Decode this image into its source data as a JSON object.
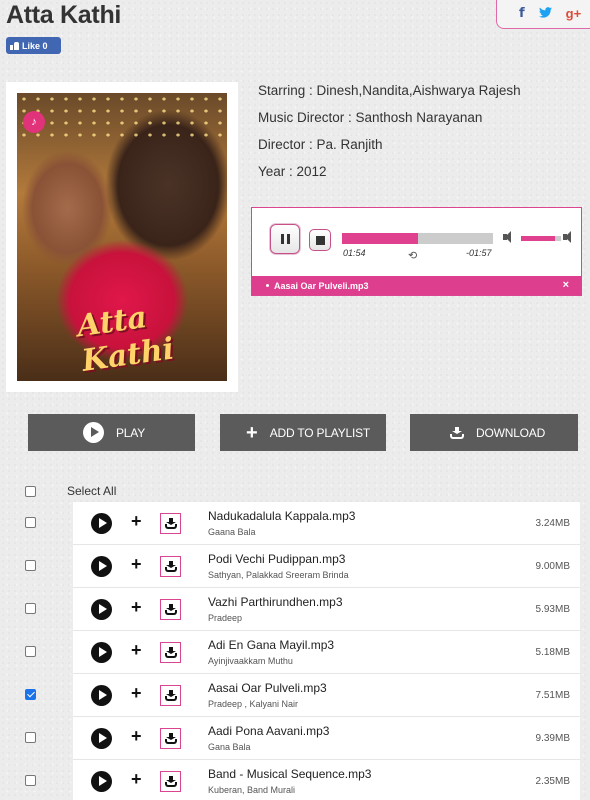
{
  "page": {
    "title": "Atta Kathi"
  },
  "fb_like": {
    "label": "Like 0"
  },
  "share": {
    "facebook": "f",
    "twitter": "t",
    "googleplus": "g+"
  },
  "poster": {
    "title_text": "Atta Kathi"
  },
  "info": {
    "starring": "Starring : Dinesh,Nandita,Aishwarya Rajesh",
    "music_director": "Music Director : Santhosh Narayanan",
    "director": "Director : Pa. Ranjith",
    "year": "Year : 2012"
  },
  "player": {
    "current_time": "01:54",
    "remaining_time": "-01:57",
    "progress_fraction": 0.5,
    "volume_fraction": 0.85,
    "now_playing": "Aasai Oar Pulveli.mp3",
    "close": "×",
    "accent_color": "#dd3f8e"
  },
  "actions": {
    "play": "PLAY",
    "add_to_playlist": "ADD TO PLAYLIST",
    "download": "DOWNLOAD"
  },
  "select_all": {
    "label": "Select All",
    "checked": false
  },
  "tracks": [
    {
      "title": "Nadukadalula Kappala.mp3",
      "artist": "Gaana Bala",
      "size": "3.24MB",
      "checked": false
    },
    {
      "title": "Podi Vechi Pudippan.mp3",
      "artist": "Sathyan, Palakkad Sreeram Brinda",
      "size": "9.00MB",
      "checked": false
    },
    {
      "title": "Vazhi Parthirundhen.mp3",
      "artist": "Pradeep",
      "size": "5.93MB",
      "checked": false
    },
    {
      "title": "Adi En Gana Mayil.mp3",
      "artist": "Ayinjivaakkam Muthu",
      "size": "5.18MB",
      "checked": false
    },
    {
      "title": "Aasai Oar Pulveli.mp3",
      "artist": "Pradeep , Kalyani Nair",
      "size": "7.51MB",
      "checked": true
    },
    {
      "title": "Aadi Pona Aavani.mp3",
      "artist": "Gana Bala",
      "size": "9.39MB",
      "checked": false
    },
    {
      "title": "Band - Musical Sequence.mp3",
      "artist": "Kuberan, Band Murali",
      "size": "2.35MB",
      "checked": false
    }
  ]
}
